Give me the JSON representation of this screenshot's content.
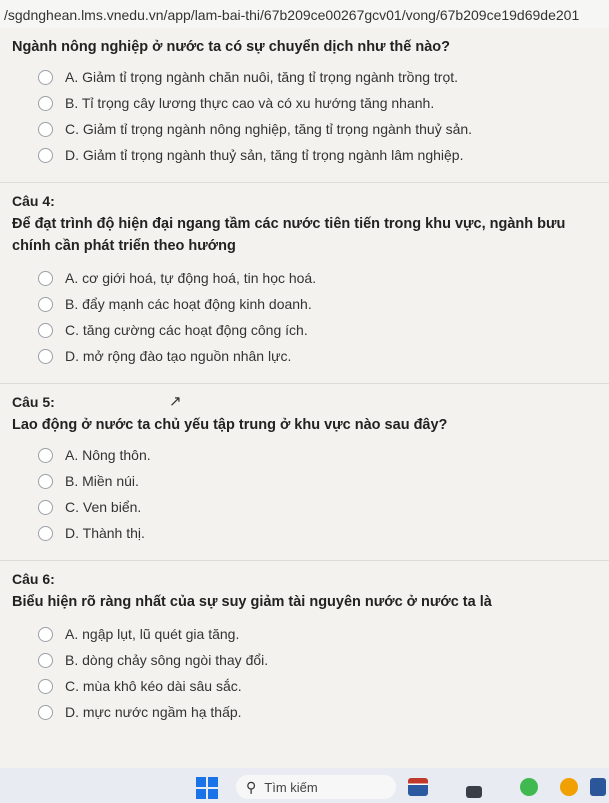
{
  "url": "/sgdnghean.lms.vnedu.vn/app/lam-bai-thi/67b209ce00267gcv01/vong/67b209ce19d69de201",
  "questions": [
    {
      "label": "",
      "text": "Ngành nông nghiệp ở nước ta có sự chuyển dịch như thế nào?",
      "options": [
        "A. Giảm tỉ trọng ngành chăn nuôi, tăng tỉ trọng ngành trồng trọt.",
        "B. Tỉ trọng cây lương thực cao và có xu hướng tăng nhanh.",
        "C. Giảm tỉ trọng ngành nông nghiệp, tăng tỉ trọng ngành thuỷ sản.",
        "D. Giảm tỉ trọng ngành thuỷ sản, tăng tỉ trọng ngành lâm nghiệp."
      ]
    },
    {
      "label": "Câu 4:",
      "text": "Để đạt trình độ hiện đại ngang tầm các nước tiên tiến trong khu vực, ngành bưu chính cần phát triển theo hướng",
      "options": [
        "A. cơ giới hoá, tự động hoá, tin học hoá.",
        "B. đẩy mạnh các hoạt động kinh doanh.",
        "C. tăng cường các hoạt động công ích.",
        "D. mở rộng đào tạo nguồn nhân lực."
      ]
    },
    {
      "label": "Câu 5:",
      "text": "Lao động ở nước ta chủ yếu tập trung ở khu vực nào sau đây?",
      "options": [
        "A. Nông thôn.",
        "B. Miền núi.",
        "C. Ven biển.",
        "D. Thành thị."
      ]
    },
    {
      "label": "Câu 6:",
      "text": "Biểu hiện rõ ràng nhất của sự suy giảm tài nguyên nước ở nước ta là",
      "options": [
        "A. ngập lụt, lũ quét gia tăng.",
        "B. dòng chảy sông ngòi thay đổi.",
        "C. mùa khô kéo dài sâu sắc.",
        "D. mực nước ngầm hạ thấp."
      ]
    }
  ],
  "taskbar": {
    "search_placeholder": "Tìm kiếm"
  }
}
